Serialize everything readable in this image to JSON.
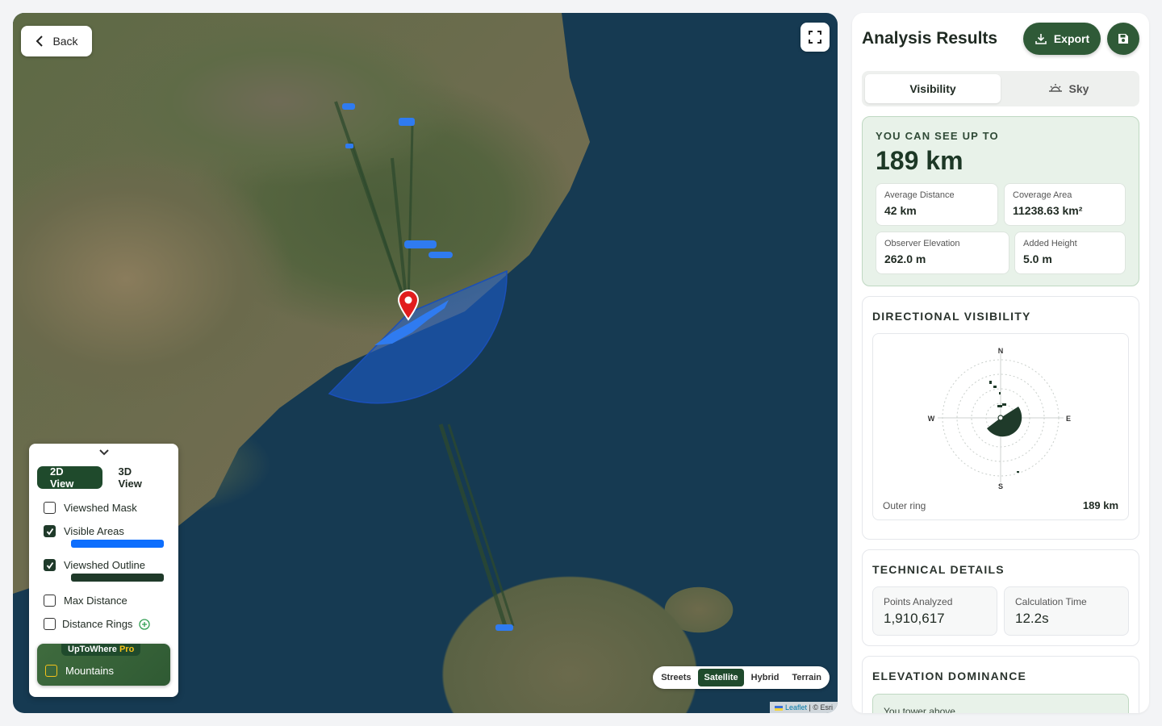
{
  "map": {
    "back_label": "Back",
    "view_tabs": [
      "2D View",
      "3D View"
    ],
    "layers": [
      {
        "label": "Viewshed Mask",
        "checked": false
      },
      {
        "label": "Visible Areas",
        "checked": true,
        "color": "#0d6efd"
      },
      {
        "label": "Viewshed Outline",
        "checked": true,
        "color": "#1f3a2a"
      },
      {
        "label": "Max Distance",
        "checked": false
      },
      {
        "label": "Distance Rings",
        "checked": false
      }
    ],
    "pro": {
      "brand": "UpToWhere",
      "tier": "Pro",
      "layer_label": "Mountains"
    },
    "basemaps": [
      "Streets",
      "Satellite",
      "Hybrid",
      "Terrain"
    ],
    "basemap_selected": "Satellite",
    "attribution": {
      "leaflet": "Leaflet",
      "rest": "| © Esri"
    },
    "colors": {
      "viewshed_fill": "#1d5fd6",
      "marker": "#e11d1d"
    }
  },
  "sidebar": {
    "title": "Analysis Results",
    "export_label": "Export",
    "tabs": [
      "Visibility",
      "Sky"
    ],
    "summary": {
      "caption": "YOU CAN SEE UP TO",
      "max_distance": "189 km",
      "stats": [
        {
          "label": "Average Distance",
          "value": "42 km"
        },
        {
          "label": "Coverage Area",
          "value": "11238.63 km²"
        },
        {
          "label": "Observer Elevation",
          "value": "262.0 m"
        },
        {
          "label": "Added Height",
          "value": "5.0 m"
        }
      ]
    },
    "directional": {
      "title": "DIRECTIONAL VISIBILITY",
      "cardinals": {
        "n": "N",
        "e": "E",
        "s": "S",
        "w": "W"
      },
      "outer_ring_label": "Outer ring",
      "outer_ring_value": "189 km"
    },
    "technical": {
      "title": "TECHNICAL DETAILS",
      "items": [
        {
          "label": "Points Analyzed",
          "value": "1,910,617"
        },
        {
          "label": "Calculation Time",
          "value": "12.2s"
        }
      ]
    },
    "elevation": {
      "title": "ELEVATION DOMINANCE",
      "preview_text": "You tower above"
    }
  }
}
